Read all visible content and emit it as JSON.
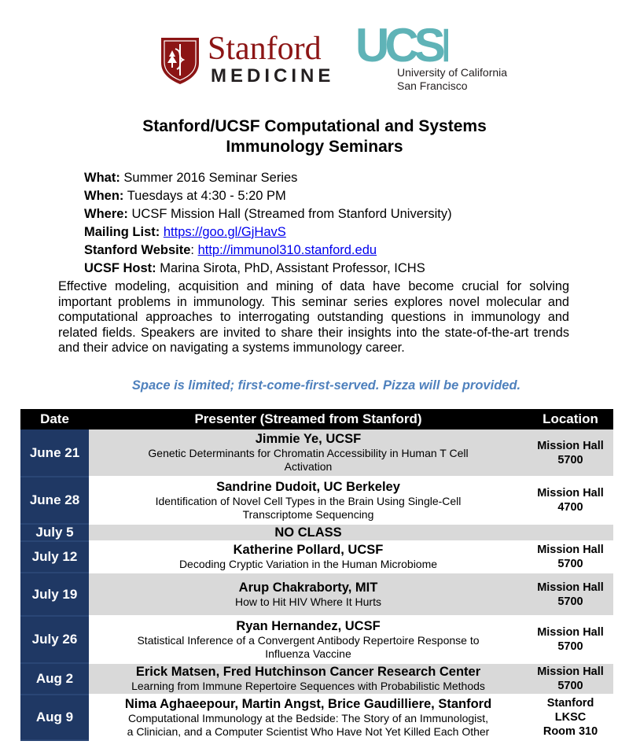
{
  "logos": {
    "stanford": {
      "name": "Stanford",
      "sub": "MEDICINE",
      "shield_color": "#8c1515"
    },
    "ucsf": {
      "mark": "UCSF",
      "line1": "University of California",
      "line2": "San Francisco",
      "mark_color": "#5fb3b7"
    }
  },
  "title": {
    "line1": "Stanford/UCSF Computational and Systems",
    "line2": "Immunology Seminars"
  },
  "info": {
    "what_label": "What:",
    "what_value": "Summer 2016 Seminar Series",
    "when_label": "When:",
    "when_value": "Tuesdays at 4:30 - 5:20 PM",
    "where_label": "Where:",
    "where_value": "UCSF Mission Hall (Streamed from Stanford University)",
    "mailing_label": "Mailing List:",
    "mailing_link": "https://goo.gl/GjHavS",
    "website_label": "Stanford Website",
    "website_sep": ":",
    "website_link": "http://immunol310.stanford.edu",
    "host_label": "UCSF Host:",
    "host_value": "Marina Sirota, PhD, Assistant Professor, ICHS"
  },
  "description": "Effective modeling, acquisition and mining of data have become crucial for solving important problems in immunology.  This seminar series explores novel molecular and computational approaches to interrogating outstanding questions in immunology and related fields.  Speakers are invited to share their insights into the state-of-the-art trends and their advice on navigating a systems immunology career.",
  "notice": "Space is limited; first-come-first-served.  Pizza will be provided.",
  "colors": {
    "header_bg": "#000000",
    "date_bg": "#1f3864",
    "row_gray": "#d9d9d9",
    "notice": "#4f81bd"
  },
  "table": {
    "headers": {
      "date": "Date",
      "presenter": "Presenter (Streamed from Stanford)",
      "location": "Location"
    },
    "rows": [
      {
        "date": "June 21",
        "presenter": "Jimmie Ye, UCSF",
        "talk1": "Genetic Determinants for Chromatin Accessibility in Human T Cell",
        "talk2": "Activation",
        "loc1": "Mission Hall",
        "loc2": "5700",
        "loc3": ""
      },
      {
        "date": "June 28",
        "presenter": "Sandrine Dudoit, UC Berkeley",
        "talk1": "Identification of Novel Cell Types in the Brain Using Single-Cell",
        "talk2": "Transcriptome Sequencing",
        "loc1": "Mission Hall",
        "loc2": "4700",
        "loc3": ""
      },
      {
        "date": "July 5",
        "presenter": "NO CLASS"
      },
      {
        "date": "July 12",
        "presenter": "Katherine Pollard, UCSF",
        "talk1": "Decoding Cryptic Variation in the Human Microbiome",
        "talk2": "",
        "loc1": "Mission Hall",
        "loc2": "5700",
        "loc3": ""
      },
      {
        "date": "July 19",
        "presenter": "Arup Chakraborty, MIT",
        "talk1": "How to Hit HIV Where It Hurts",
        "talk2": "",
        "loc1": "Mission Hall",
        "loc2": "5700",
        "loc3": ""
      },
      {
        "date": "July 26",
        "presenter": "Ryan Hernandez, UCSF",
        "talk1": "Statistical Inference of a Convergent Antibody Repertoire Response to",
        "talk2": "Influenza Vaccine",
        "loc1": "Mission Hall",
        "loc2": "5700",
        "loc3": ""
      },
      {
        "date": "Aug 2",
        "presenter": "Erick Matsen, Fred Hutchinson Cancer Research Center",
        "talk1": "Learning from Immune Repertoire Sequences with Probabilistic Methods",
        "talk2": "",
        "loc1": "Mission Hall",
        "loc2": "5700",
        "loc3": ""
      },
      {
        "date": "Aug 9",
        "presenter": "Nima Aghaeepour, Martin Angst, Brice Gaudilliere, Stanford",
        "talk1": "Computational Immunology at the Bedside: The Story of an Immunologist,",
        "talk2": "a Clinician, and a Computer Scientist Who Have Not Yet Killed Each Other",
        "loc1": "Stanford",
        "loc2": "LKSC",
        "loc3": "Room 310"
      }
    ]
  }
}
